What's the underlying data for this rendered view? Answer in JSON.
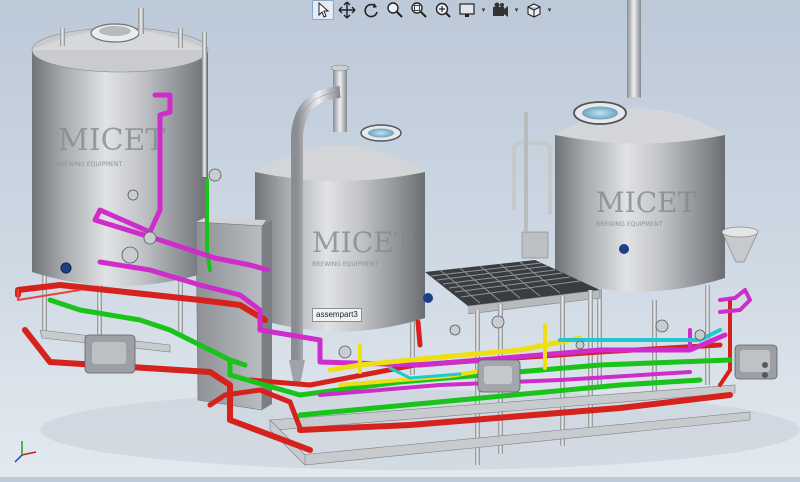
{
  "toolbar": {
    "buttons": [
      {
        "name": "select-arrow-icon",
        "active": true,
        "caret": false
      },
      {
        "name": "pan-icon",
        "active": false,
        "caret": false
      },
      {
        "name": "rotate-view-icon",
        "active": false,
        "caret": false
      },
      {
        "name": "zoom-to-fit-icon",
        "active": false,
        "caret": false
      },
      {
        "name": "zoom-area-icon",
        "active": false,
        "caret": false
      },
      {
        "name": "zoom-in-out-icon",
        "active": false,
        "caret": false
      },
      {
        "name": "display-style-icon",
        "active": false,
        "caret": true
      },
      {
        "name": "view-settings-icon",
        "active": false,
        "caret": true
      },
      {
        "name": "view-orientation-cube-icon",
        "active": false,
        "caret": true
      }
    ]
  },
  "model": {
    "tooltip_label": "assempart3",
    "tank_logo_text": "MICET",
    "tank_logo_subtext": "BREWING EQUIPMENT",
    "colors": {
      "steel": "#b5b7bb",
      "pipe_red": "#e41b17",
      "pipe_green": "#1fd31f",
      "pipe_magenta": "#d72fd4",
      "pipe_yellow": "#f2e21a",
      "pipe_cyan": "#25cbd6",
      "panel": "#a9adb1"
    }
  }
}
